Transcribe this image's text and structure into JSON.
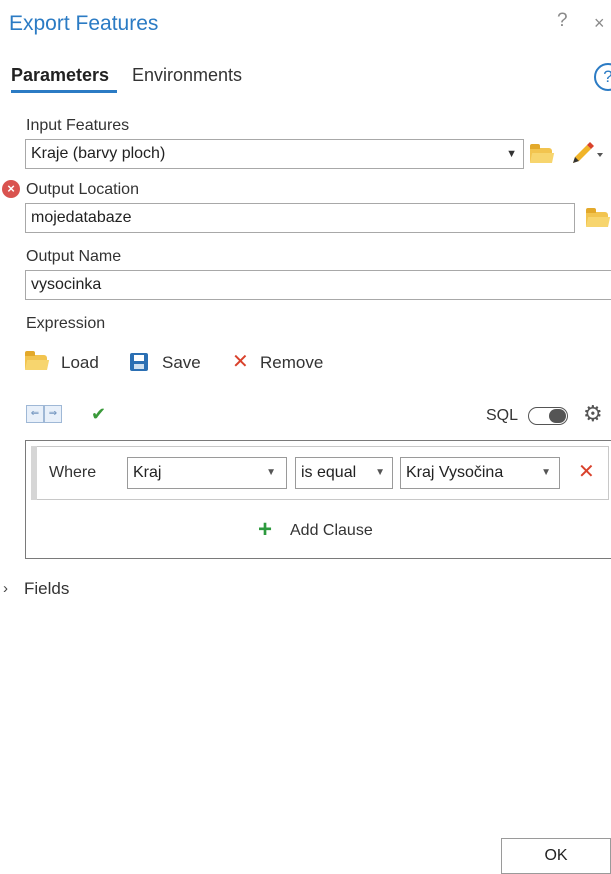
{
  "window": {
    "title": "Export Features",
    "help_glyph": "?",
    "close_glyph": "×"
  },
  "tabs": {
    "parameters": "Parameters",
    "environments": "Environments",
    "help_glyph": "?"
  },
  "input_features": {
    "label": "Input Features",
    "value": "Kraje (barvy ploch)"
  },
  "output_location": {
    "label": "Output Location",
    "value": "mojedatabaze",
    "error_glyph": "×"
  },
  "output_name": {
    "label": "Output Name",
    "value": "vysocinka"
  },
  "expression": {
    "label": "Expression",
    "load_label": "Load",
    "save_label": "Save",
    "remove_label": "Remove",
    "sql_label": "SQL",
    "sql_enabled": true,
    "clause": {
      "where_label": "Where",
      "field": "Kraj",
      "operator": "is equal",
      "value": "Kraj Vysočina"
    },
    "add_clause_label": "Add Clause"
  },
  "fields_section": {
    "label": "Fields",
    "expanded": false
  },
  "footer": {
    "ok_label": "OK"
  },
  "colors": {
    "accent": "#2b7bc4",
    "error": "#d9534f",
    "remove": "#d9412b",
    "add": "#2d9a3e"
  }
}
